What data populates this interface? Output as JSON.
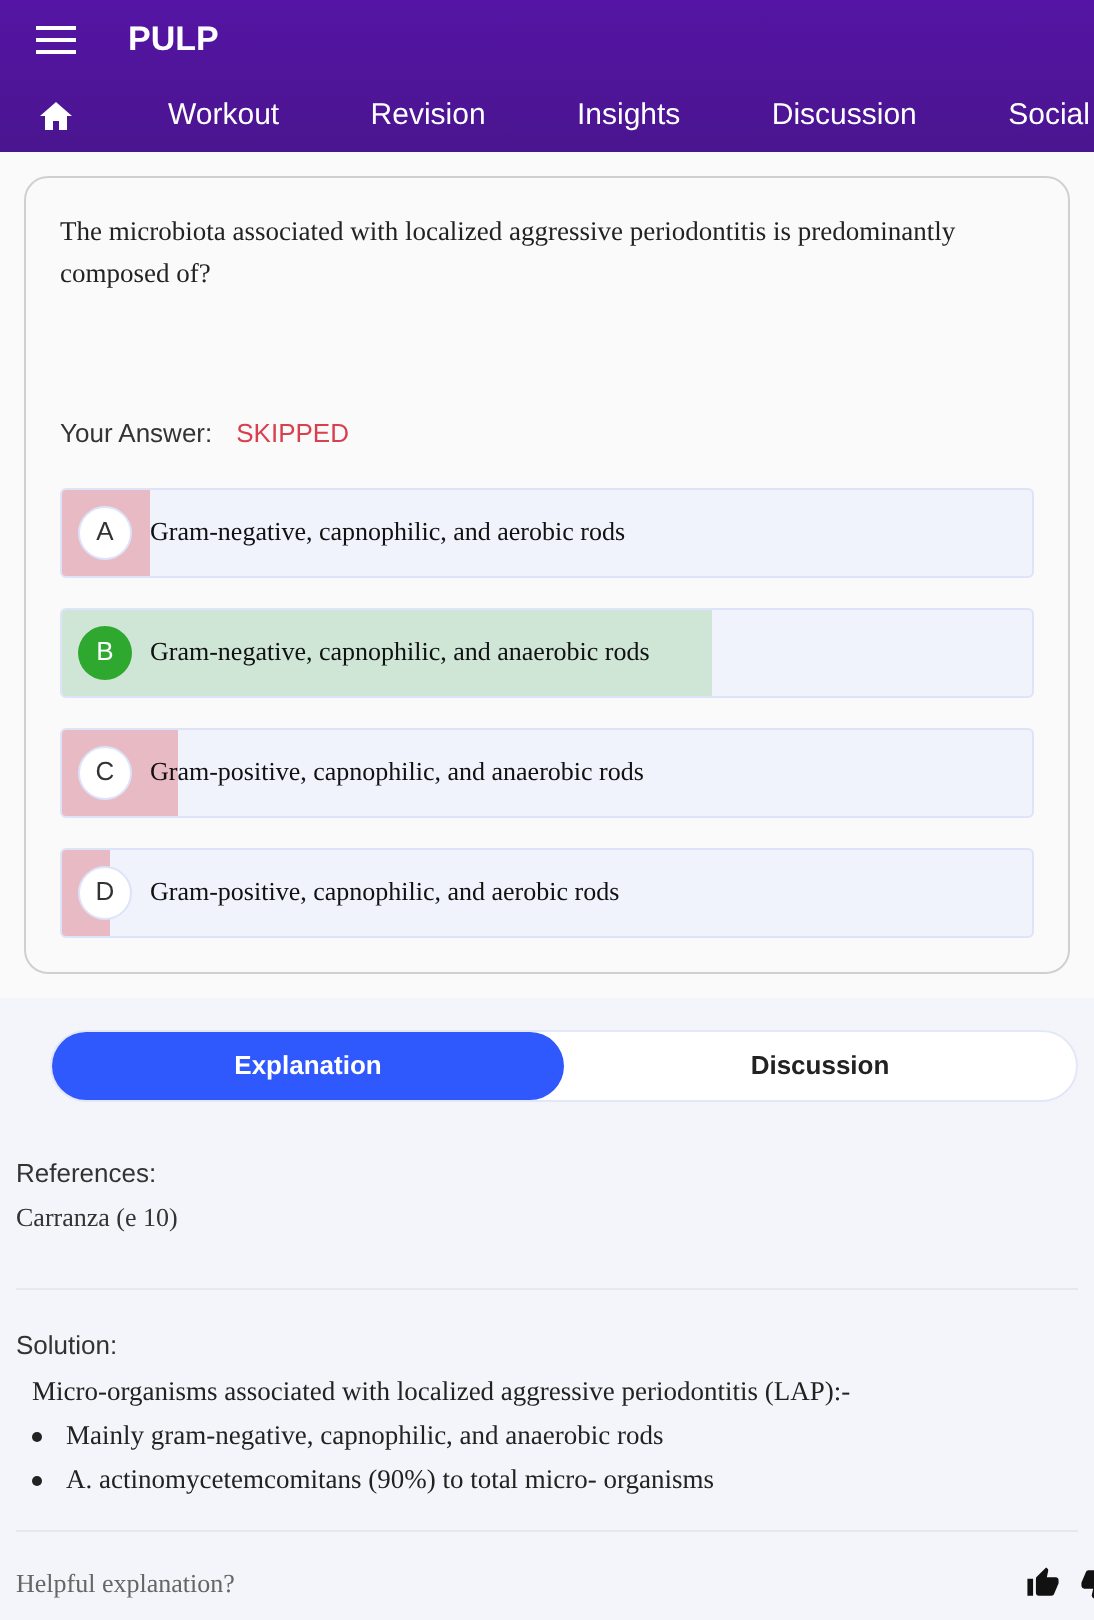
{
  "app_bar": {
    "title": "PULP"
  },
  "nav": [
    {
      "label": "Workout"
    },
    {
      "label": "Revision"
    },
    {
      "label": "Insights"
    },
    {
      "label": "Discussion"
    },
    {
      "label": "Social"
    }
  ],
  "question": {
    "text": "The microbiota associated with localized aggressive periodontitis is predominantly composed of?",
    "answer_label": "Your Answer:",
    "answer_value": "SKIPPED"
  },
  "options": [
    {
      "letter": "A",
      "text": "Gram-negative, capnophilic, and aerobic rods",
      "correct": false,
      "level": 0.09
    },
    {
      "letter": "B",
      "text": "Gram-negative, capnophilic, and anaerobic rods",
      "correct": true,
      "level": 0.67
    },
    {
      "letter": "C",
      "text": "Gram-positive, capnophilic, and anaerobic rods",
      "correct": false,
      "level": 0.12
    },
    {
      "letter": "D",
      "text": "Gram-positive, capnophilic, and aerobic rods",
      "correct": false,
      "level": 0.05
    }
  ],
  "tabs": [
    {
      "label": "Explanation",
      "selected": true
    },
    {
      "label": "Discussion",
      "selected": false
    }
  ],
  "references": {
    "heading": "References:",
    "text": "Carranza (e 10)"
  },
  "solution": {
    "heading": "Solution:",
    "intro": "Micro-organisms associated with localized aggressive periodontitis (LAP):-",
    "bullets": [
      "Mainly gram-negative, capnophilic, and anaerobic rods",
      "A. actinomycetemcomitans (90%) to total micro- organisms"
    ]
  },
  "feedback": {
    "prompt": "Helpful explanation?"
  }
}
